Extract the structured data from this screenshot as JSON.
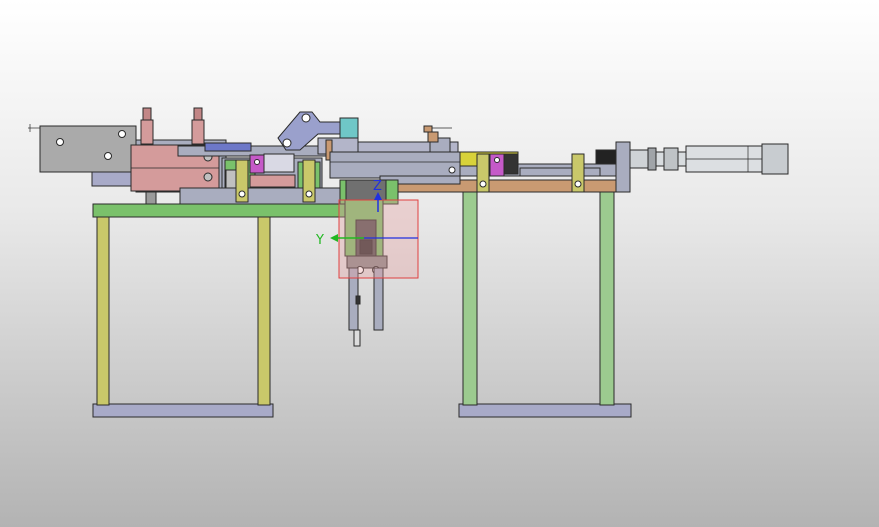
{
  "viewport": {
    "colors": {
      "frame_green": "#7ac16b",
      "leg_yellow": "#c9c86a",
      "leg_green": "#9ccb8f",
      "base_lavender": "#a8aac8",
      "cylinder_pink": "#d49b9b",
      "slide_gray": "#a9adbf",
      "plate_tan": "#c99a72",
      "accent_magenta": "#c55ac8",
      "accent_yellow": "#d8d23a",
      "silver": "#cfd3d6",
      "triad_x": "#2030e0",
      "triad_y": "#22b822",
      "triad_z": "#2030e0",
      "selection_red": "#e04040"
    }
  },
  "triad": {
    "y_label": "Y",
    "z_label": "Z"
  }
}
